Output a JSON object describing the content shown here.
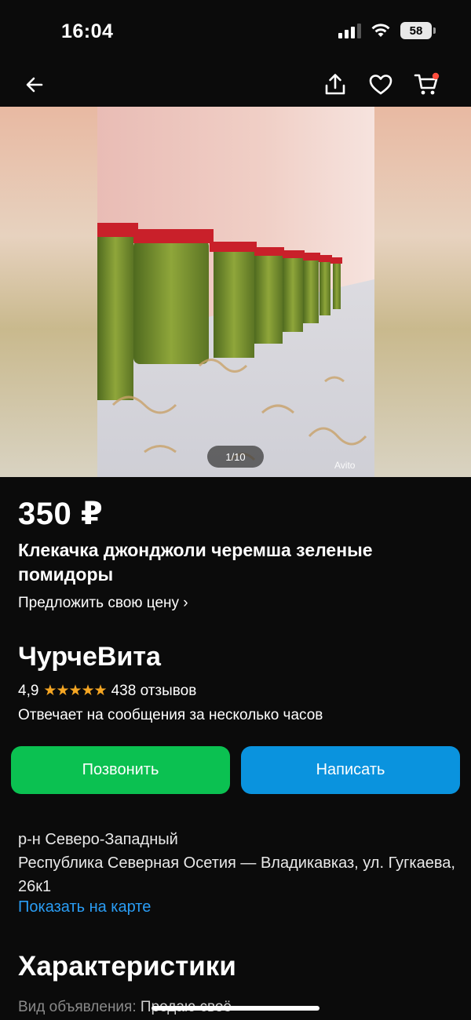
{
  "status": {
    "time": "16:04",
    "battery": "58"
  },
  "nav": {
    "back_icon": "arrow-left-icon",
    "share_icon": "share-icon",
    "favorite_icon": "heart-icon",
    "cart_icon": "cart-icon",
    "cart_badge_color": "#ff4d3d"
  },
  "gallery": {
    "counter": "1/10",
    "watermark": "Avito"
  },
  "listing": {
    "price": "350 ₽",
    "title": "Клекачка джонджоли черемша зеленые помидоры",
    "offer_price_link": "Предложить свою цену ›"
  },
  "seller": {
    "name": "ЧурчеВита",
    "rating": "4,9",
    "stars": "★★★★★",
    "reviews": "438 отзывов",
    "response_time": "Отвечает на сообщения за несколько часов"
  },
  "actions": {
    "call_label": "Позвонить",
    "write_label": "Написать",
    "call_color": "#0bc151",
    "write_color": "#0a93de"
  },
  "location": {
    "district": "р-н Северо-Западный",
    "address": "Республика Северная Осетия — Владикавказ, ул. Гугкаева, 26к1",
    "map_link": "Показать на карте"
  },
  "characteristics": {
    "title": "Характеристики",
    "ad_type_label": "Вид объявления: ",
    "ad_type_value": "Продаю своё"
  }
}
